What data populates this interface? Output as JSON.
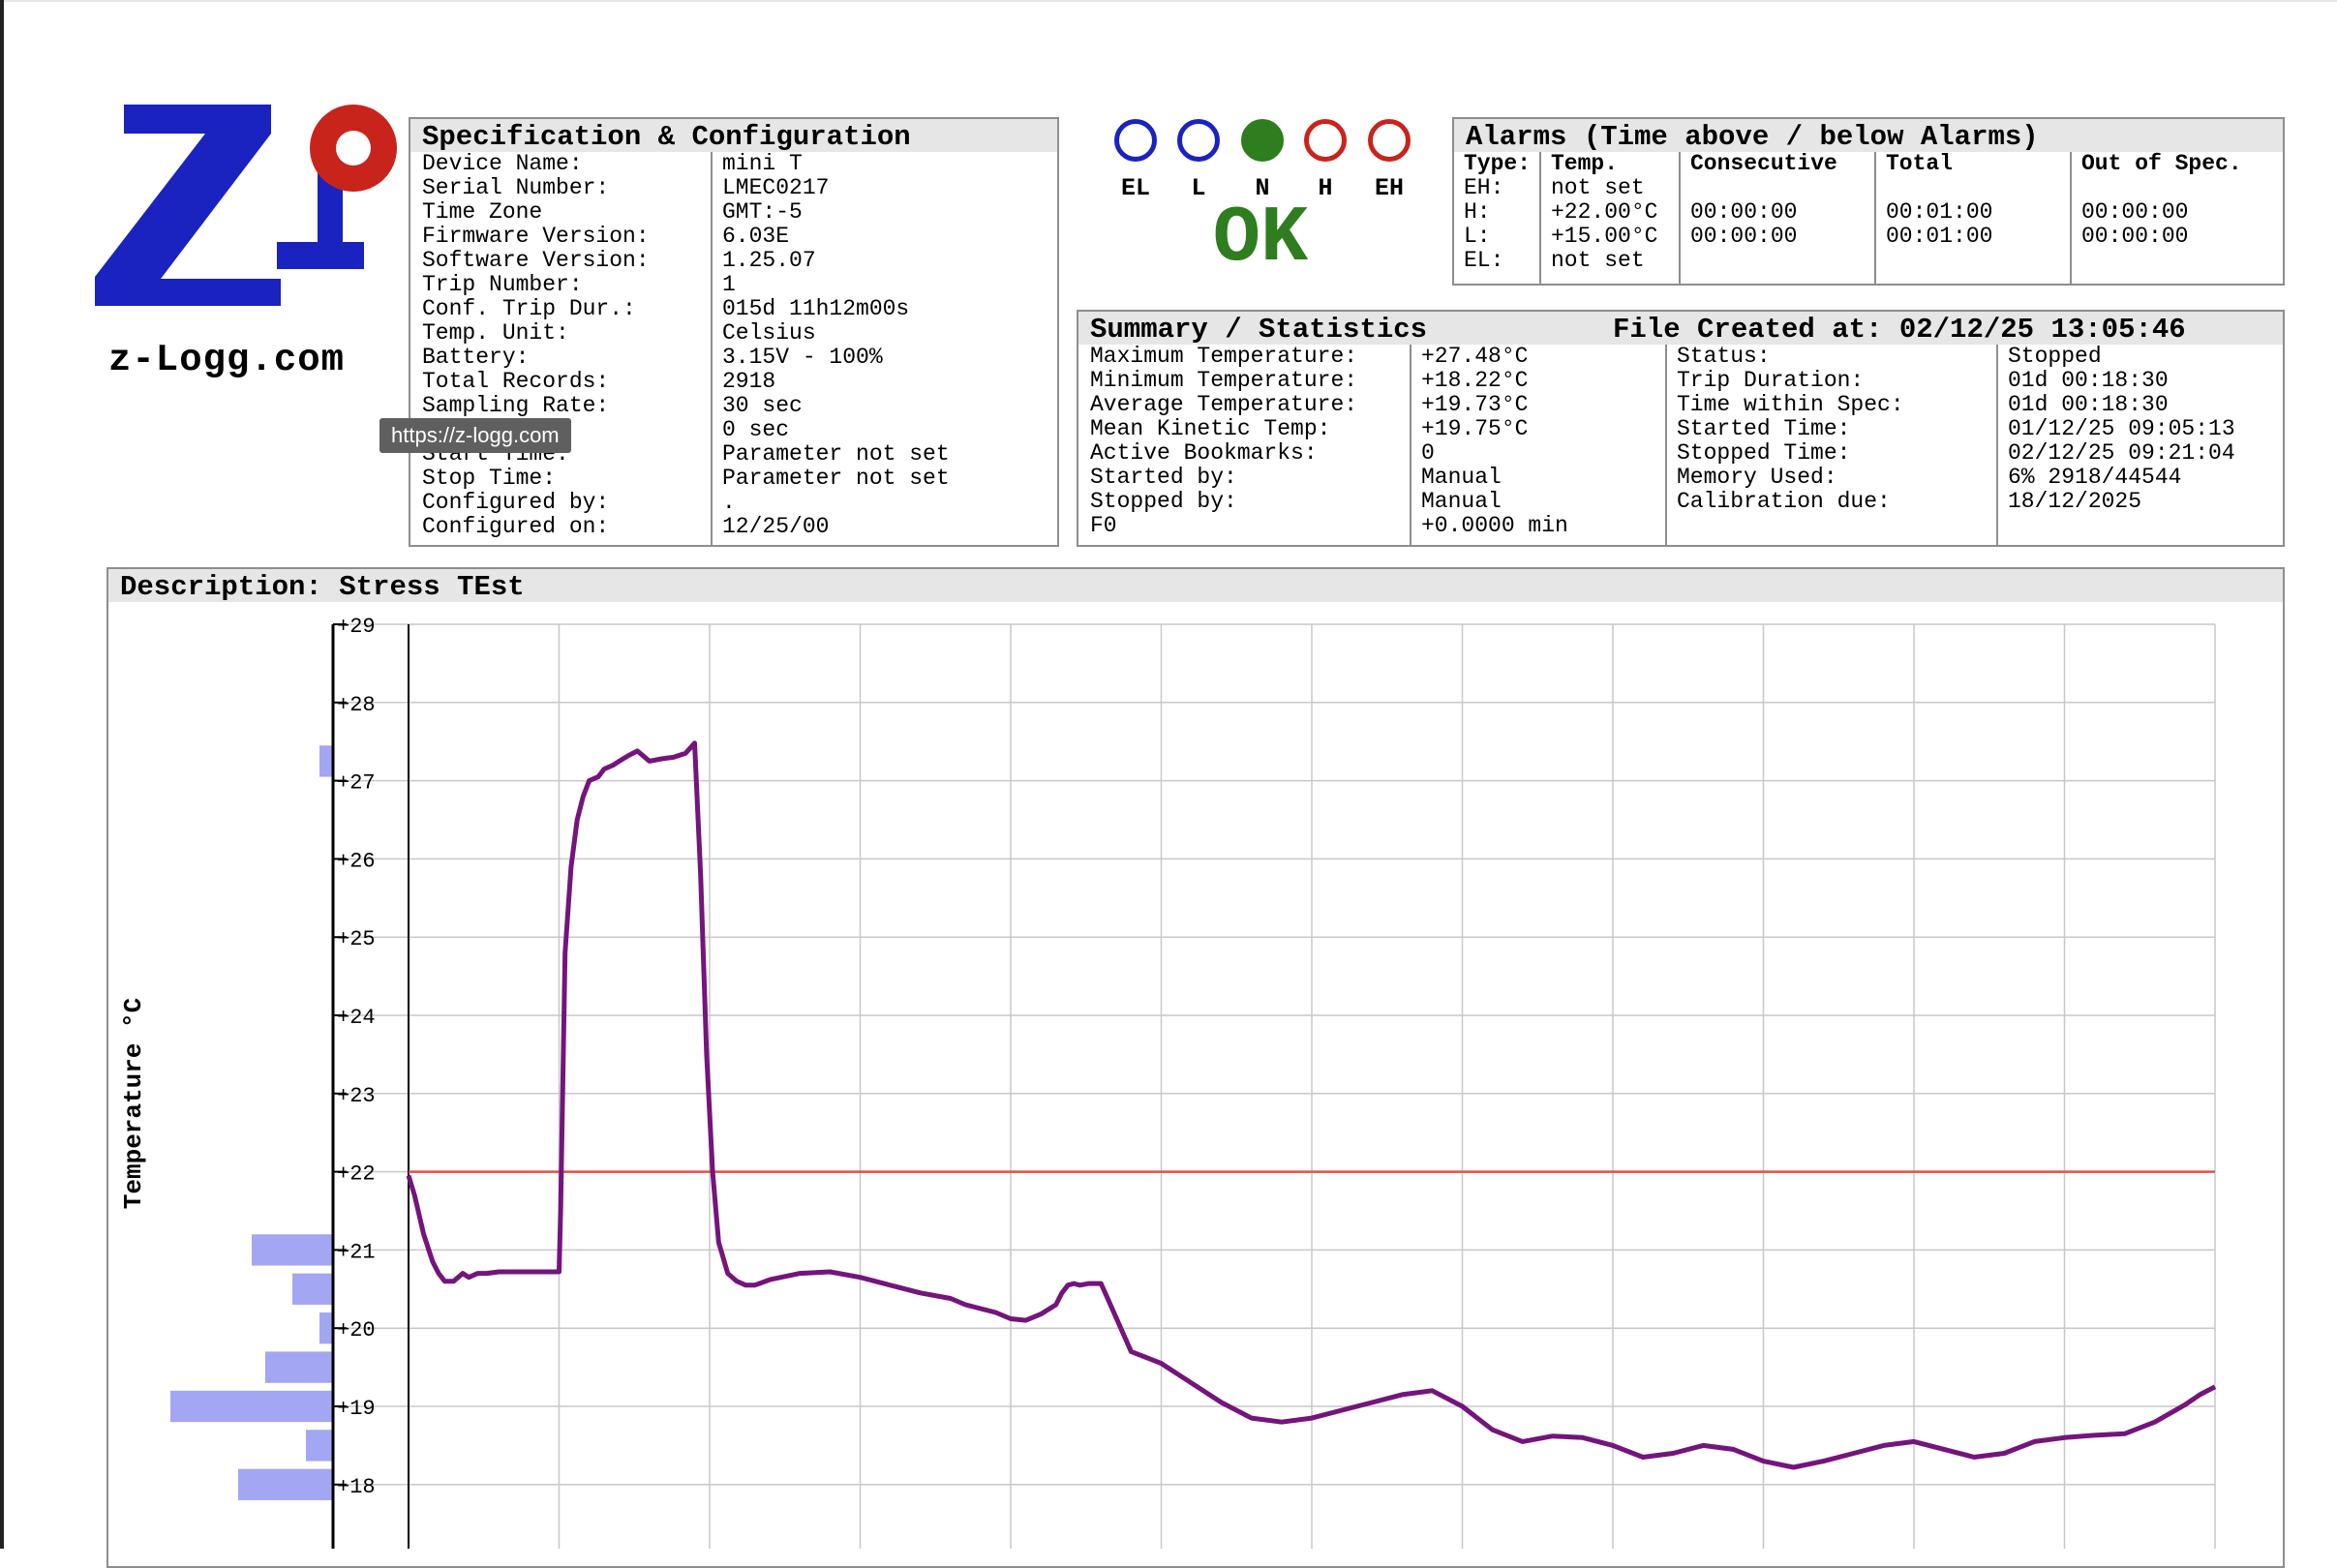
{
  "logo": {
    "caption": "z-Logg.com",
    "colors": {
      "blue": "#1a22c0",
      "red": "#c8241c"
    }
  },
  "tooltip": {
    "text": "https://z-logg.com"
  },
  "spec": {
    "title": "Specification & Configuration",
    "rows": [
      {
        "label": "Device Name:",
        "value": "mini T"
      },
      {
        "label": "Serial Number:",
        "value": "LMEC0217"
      },
      {
        "label": "Time Zone",
        "value": "GMT:-5"
      },
      {
        "label": "Firmware Version:",
        "value": "6.03E"
      },
      {
        "label": "Software Version:",
        "value": "1.25.07"
      },
      {
        "label": "Trip Number:",
        "value": "1"
      },
      {
        "label": "Conf. Trip Dur.:",
        "value": "015d 11h12m00s"
      },
      {
        "label": "Temp. Unit:",
        "value": "Celsius"
      },
      {
        "label": "Battery:",
        "value": "3.15V - 100%"
      },
      {
        "label": "Total Records:",
        "value": "2918"
      },
      {
        "label": "Sampling Rate:",
        "value": "30 sec"
      },
      {
        "label": "",
        "value": "0 sec"
      },
      {
        "label": "Start Time:",
        "value": "Parameter not set"
      },
      {
        "label": "Stop Time:",
        "value": "Parameter not set"
      },
      {
        "label": "Configured by:",
        "value": "."
      },
      {
        "label": "Configured on:",
        "value": "12/25/00"
      }
    ]
  },
  "indicator": {
    "leds": [
      {
        "label": "EL",
        "state": "off",
        "color": "#1a22c0"
      },
      {
        "label": "L",
        "state": "off",
        "color": "#1a22c0"
      },
      {
        "label": "N",
        "state": "on",
        "color": "#2e7d1f"
      },
      {
        "label": "H",
        "state": "off",
        "color": "#c8241c"
      },
      {
        "label": "EH",
        "state": "off",
        "color": "#c8241c"
      }
    ],
    "status": "OK",
    "status_color": "#2e7d1f"
  },
  "alarms": {
    "title": "Alarms (Time above / below Alarms)",
    "headers": [
      "Type:",
      "Temp.",
      "Consecutive",
      "Total",
      "Out of Spec."
    ],
    "rows": [
      {
        "type": "EH:",
        "temp": "not set",
        "consecutive": "",
        "total": "",
        "out": ""
      },
      {
        "type": "H:",
        "temp": "+22.00°C",
        "consecutive": "00:00:00",
        "total": "00:01:00",
        "out": "00:00:00"
      },
      {
        "type": "L:",
        "temp": "+15.00°C",
        "consecutive": "00:00:00",
        "total": "00:01:00",
        "out": "00:00:00"
      },
      {
        "type": "EL:",
        "temp": "not set",
        "consecutive": "",
        "total": "",
        "out": ""
      }
    ]
  },
  "summary": {
    "title": "Summary / Statistics",
    "file_created": "File Created at: 02/12/25 13:05:46",
    "left_rows": [
      {
        "label": "Maximum Temperature:",
        "value": "+27.48°C"
      },
      {
        "label": "Minimum Temperature:",
        "value": "+18.22°C"
      },
      {
        "label": "Average Temperature:",
        "value": "+19.73°C"
      },
      {
        "label": "Mean Kinetic Temp:",
        "value": "+19.75°C"
      },
      {
        "label": "Active Bookmarks:",
        "value": "0"
      },
      {
        "label": "Started by:",
        "value": "Manual"
      },
      {
        "label": "Stopped by:",
        "value": "Manual"
      },
      {
        "label": "F0",
        "value": "+0.0000 min"
      }
    ],
    "right_rows": [
      {
        "label": "Status:",
        "value": "Stopped"
      },
      {
        "label": "Trip Duration:",
        "value": "01d 00:18:30"
      },
      {
        "label": "Time within Spec:",
        "value": "01d 00:18:30"
      },
      {
        "label": "Started Time:",
        "value": "01/12/25 09:05:13"
      },
      {
        "label": "Stopped Time:",
        "value": "02/12/25 09:21:04"
      },
      {
        "label": "Memory Used:",
        "value": "6% 2918/44544"
      },
      {
        "label": "Calibration due:",
        "value": "18/12/2025"
      }
    ]
  },
  "description": {
    "title": "Description: Stress TEst"
  },
  "chart_data": {
    "type": "line",
    "ylabel": "Temperature °C",
    "y_ticks": [
      "+18",
      "+19",
      "+20",
      "+21",
      "+22",
      "+23",
      "+24",
      "+25",
      "+26",
      "+27",
      "+28",
      "+29"
    ],
    "ylim": [
      17.2,
      29
    ],
    "grid": true,
    "line_color": "#74147c",
    "alarm_line": {
      "value": 22,
      "color": "#e0504a"
    },
    "x": [
      0,
      0.2,
      0.5,
      0.8,
      1.0,
      1.2,
      1.5,
      1.8,
      2.0,
      2.3,
      2.6,
      3.0,
      3.5,
      4.0,
      4.5,
      5.0,
      5.05,
      5.2,
      5.4,
      5.6,
      5.8,
      6.0,
      6.3,
      6.5,
      6.8,
      7.0,
      7.3,
      7.6,
      8.0,
      8.4,
      8.8,
      9.2,
      9.5,
      9.7,
      9.9,
      10.1,
      10.3,
      10.6,
      10.9,
      11.2,
      11.5,
      12,
      13,
      14,
      15,
      16,
      17,
      18,
      18.5,
      19,
      19.5,
      20,
      20.5,
      21,
      21.5,
      21.7,
      21.9,
      22.1,
      22.3,
      22.6,
      23,
      24,
      25,
      26,
      27,
      28,
      29,
      30,
      31,
      32,
      33,
      34,
      35,
      36,
      37,
      38,
      39,
      40,
      41,
      42,
      43,
      44,
      45,
      46,
      47,
      48,
      49,
      50,
      51,
      52,
      53,
      54,
      55,
      56,
      57,
      58,
      59,
      59.5,
      60
    ],
    "values": [
      21.95,
      21.7,
      21.2,
      20.85,
      20.7,
      20.6,
      20.6,
      20.7,
      20.65,
      20.7,
      20.7,
      20.72,
      20.72,
      20.72,
      20.72,
      20.72,
      21.5,
      24.8,
      25.9,
      26.5,
      26.8,
      27.0,
      27.05,
      27.15,
      27.2,
      27.25,
      27.32,
      27.38,
      27.25,
      27.28,
      27.3,
      27.35,
      27.48,
      25.8,
      23.5,
      22.0,
      21.1,
      20.7,
      20.6,
      20.55,
      20.55,
      20.62,
      20.7,
      20.72,
      20.65,
      20.55,
      20.45,
      20.38,
      20.3,
      20.25,
      20.2,
      20.12,
      20.1,
      20.18,
      20.3,
      20.45,
      20.55,
      20.57,
      20.55,
      20.57,
      20.57,
      19.7,
      19.55,
      19.3,
      19.05,
      18.85,
      18.8,
      18.85,
      18.95,
      19.05,
      19.15,
      19.2,
      19.0,
      18.7,
      18.55,
      18.62,
      18.6,
      18.5,
      18.35,
      18.4,
      18.5,
      18.45,
      18.3,
      18.22,
      18.3,
      18.4,
      18.5,
      18.55,
      18.45,
      18.35,
      18.4,
      18.55,
      18.6,
      18.63,
      18.65,
      18.8,
      19.02,
      19.15,
      19.25
    ],
    "histogram": [
      {
        "temp": 18,
        "count": 7
      },
      {
        "temp": 18.5,
        "count": 2
      },
      {
        "temp": 19,
        "count": 12
      },
      {
        "temp": 19.5,
        "count": 5
      },
      {
        "temp": 20,
        "count": 1
      },
      {
        "temp": 20.5,
        "count": 3
      },
      {
        "temp": 21,
        "count": 6
      },
      {
        "temp": 27.25,
        "count": 1
      }
    ],
    "histogram_color": "#a3a6f2"
  }
}
